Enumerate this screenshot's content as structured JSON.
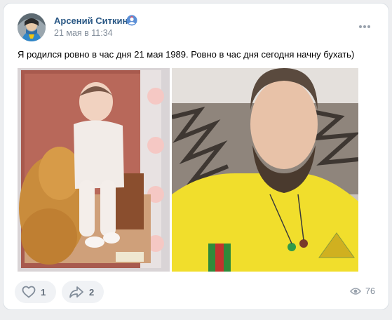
{
  "post": {
    "author_name": "Арсений Ситкин",
    "date": "21 мая в 11:34",
    "text": "Я родился ровно в час дня 21 мая 1989. Ровно в час дня сегодня начну бухать)",
    "actions": {
      "like_count": "1",
      "share_count": "2",
      "views_count": "76"
    },
    "icons": {
      "badge": "shield-badge-icon",
      "more": "more-horizontal-icon",
      "like": "heart-icon",
      "share": "share-arrow-icon",
      "views": "eye-icon"
    }
  },
  "colors": {
    "author": "#2a5885",
    "secondary_text": "#818c99",
    "button_bg": "#f0f2f5"
  }
}
